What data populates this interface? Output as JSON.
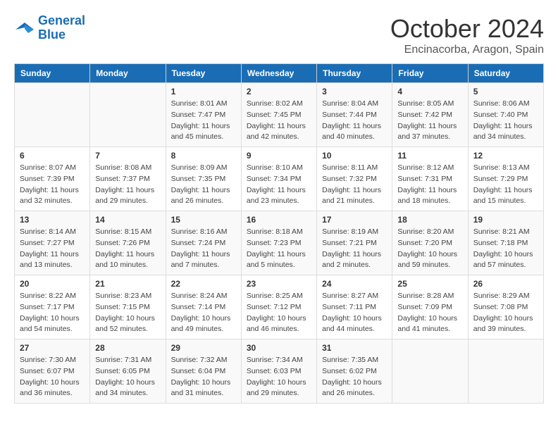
{
  "header": {
    "logo_line1": "General",
    "logo_line2": "Blue",
    "month": "October 2024",
    "location": "Encinacorba, Aragon, Spain"
  },
  "weekdays": [
    "Sunday",
    "Monday",
    "Tuesday",
    "Wednesday",
    "Thursday",
    "Friday",
    "Saturday"
  ],
  "rows": [
    [
      {
        "day": "",
        "detail": ""
      },
      {
        "day": "",
        "detail": ""
      },
      {
        "day": "1",
        "detail": "Sunrise: 8:01 AM\nSunset: 7:47 PM\nDaylight: 11 hours\nand 45 minutes."
      },
      {
        "day": "2",
        "detail": "Sunrise: 8:02 AM\nSunset: 7:45 PM\nDaylight: 11 hours\nand 42 minutes."
      },
      {
        "day": "3",
        "detail": "Sunrise: 8:04 AM\nSunset: 7:44 PM\nDaylight: 11 hours\nand 40 minutes."
      },
      {
        "day": "4",
        "detail": "Sunrise: 8:05 AM\nSunset: 7:42 PM\nDaylight: 11 hours\nand 37 minutes."
      },
      {
        "day": "5",
        "detail": "Sunrise: 8:06 AM\nSunset: 7:40 PM\nDaylight: 11 hours\nand 34 minutes."
      }
    ],
    [
      {
        "day": "6",
        "detail": "Sunrise: 8:07 AM\nSunset: 7:39 PM\nDaylight: 11 hours\nand 32 minutes."
      },
      {
        "day": "7",
        "detail": "Sunrise: 8:08 AM\nSunset: 7:37 PM\nDaylight: 11 hours\nand 29 minutes."
      },
      {
        "day": "8",
        "detail": "Sunrise: 8:09 AM\nSunset: 7:35 PM\nDaylight: 11 hours\nand 26 minutes."
      },
      {
        "day": "9",
        "detail": "Sunrise: 8:10 AM\nSunset: 7:34 PM\nDaylight: 11 hours\nand 23 minutes."
      },
      {
        "day": "10",
        "detail": "Sunrise: 8:11 AM\nSunset: 7:32 PM\nDaylight: 11 hours\nand 21 minutes."
      },
      {
        "day": "11",
        "detail": "Sunrise: 8:12 AM\nSunset: 7:31 PM\nDaylight: 11 hours\nand 18 minutes."
      },
      {
        "day": "12",
        "detail": "Sunrise: 8:13 AM\nSunset: 7:29 PM\nDaylight: 11 hours\nand 15 minutes."
      }
    ],
    [
      {
        "day": "13",
        "detail": "Sunrise: 8:14 AM\nSunset: 7:27 PM\nDaylight: 11 hours\nand 13 minutes."
      },
      {
        "day": "14",
        "detail": "Sunrise: 8:15 AM\nSunset: 7:26 PM\nDaylight: 11 hours\nand 10 minutes."
      },
      {
        "day": "15",
        "detail": "Sunrise: 8:16 AM\nSunset: 7:24 PM\nDaylight: 11 hours\nand 7 minutes."
      },
      {
        "day": "16",
        "detail": "Sunrise: 8:18 AM\nSunset: 7:23 PM\nDaylight: 11 hours\nand 5 minutes."
      },
      {
        "day": "17",
        "detail": "Sunrise: 8:19 AM\nSunset: 7:21 PM\nDaylight: 11 hours\nand 2 minutes."
      },
      {
        "day": "18",
        "detail": "Sunrise: 8:20 AM\nSunset: 7:20 PM\nDaylight: 10 hours\nand 59 minutes."
      },
      {
        "day": "19",
        "detail": "Sunrise: 8:21 AM\nSunset: 7:18 PM\nDaylight: 10 hours\nand 57 minutes."
      }
    ],
    [
      {
        "day": "20",
        "detail": "Sunrise: 8:22 AM\nSunset: 7:17 PM\nDaylight: 10 hours\nand 54 minutes."
      },
      {
        "day": "21",
        "detail": "Sunrise: 8:23 AM\nSunset: 7:15 PM\nDaylight: 10 hours\nand 52 minutes."
      },
      {
        "day": "22",
        "detail": "Sunrise: 8:24 AM\nSunset: 7:14 PM\nDaylight: 10 hours\nand 49 minutes."
      },
      {
        "day": "23",
        "detail": "Sunrise: 8:25 AM\nSunset: 7:12 PM\nDaylight: 10 hours\nand 46 minutes."
      },
      {
        "day": "24",
        "detail": "Sunrise: 8:27 AM\nSunset: 7:11 PM\nDaylight: 10 hours\nand 44 minutes."
      },
      {
        "day": "25",
        "detail": "Sunrise: 8:28 AM\nSunset: 7:09 PM\nDaylight: 10 hours\nand 41 minutes."
      },
      {
        "day": "26",
        "detail": "Sunrise: 8:29 AM\nSunset: 7:08 PM\nDaylight: 10 hours\nand 39 minutes."
      }
    ],
    [
      {
        "day": "27",
        "detail": "Sunrise: 7:30 AM\nSunset: 6:07 PM\nDaylight: 10 hours\nand 36 minutes."
      },
      {
        "day": "28",
        "detail": "Sunrise: 7:31 AM\nSunset: 6:05 PM\nDaylight: 10 hours\nand 34 minutes."
      },
      {
        "day": "29",
        "detail": "Sunrise: 7:32 AM\nSunset: 6:04 PM\nDaylight: 10 hours\nand 31 minutes."
      },
      {
        "day": "30",
        "detail": "Sunrise: 7:34 AM\nSunset: 6:03 PM\nDaylight: 10 hours\nand 29 minutes."
      },
      {
        "day": "31",
        "detail": "Sunrise: 7:35 AM\nSunset: 6:02 PM\nDaylight: 10 hours\nand 26 minutes."
      },
      {
        "day": "",
        "detail": ""
      },
      {
        "day": "",
        "detail": ""
      }
    ]
  ]
}
